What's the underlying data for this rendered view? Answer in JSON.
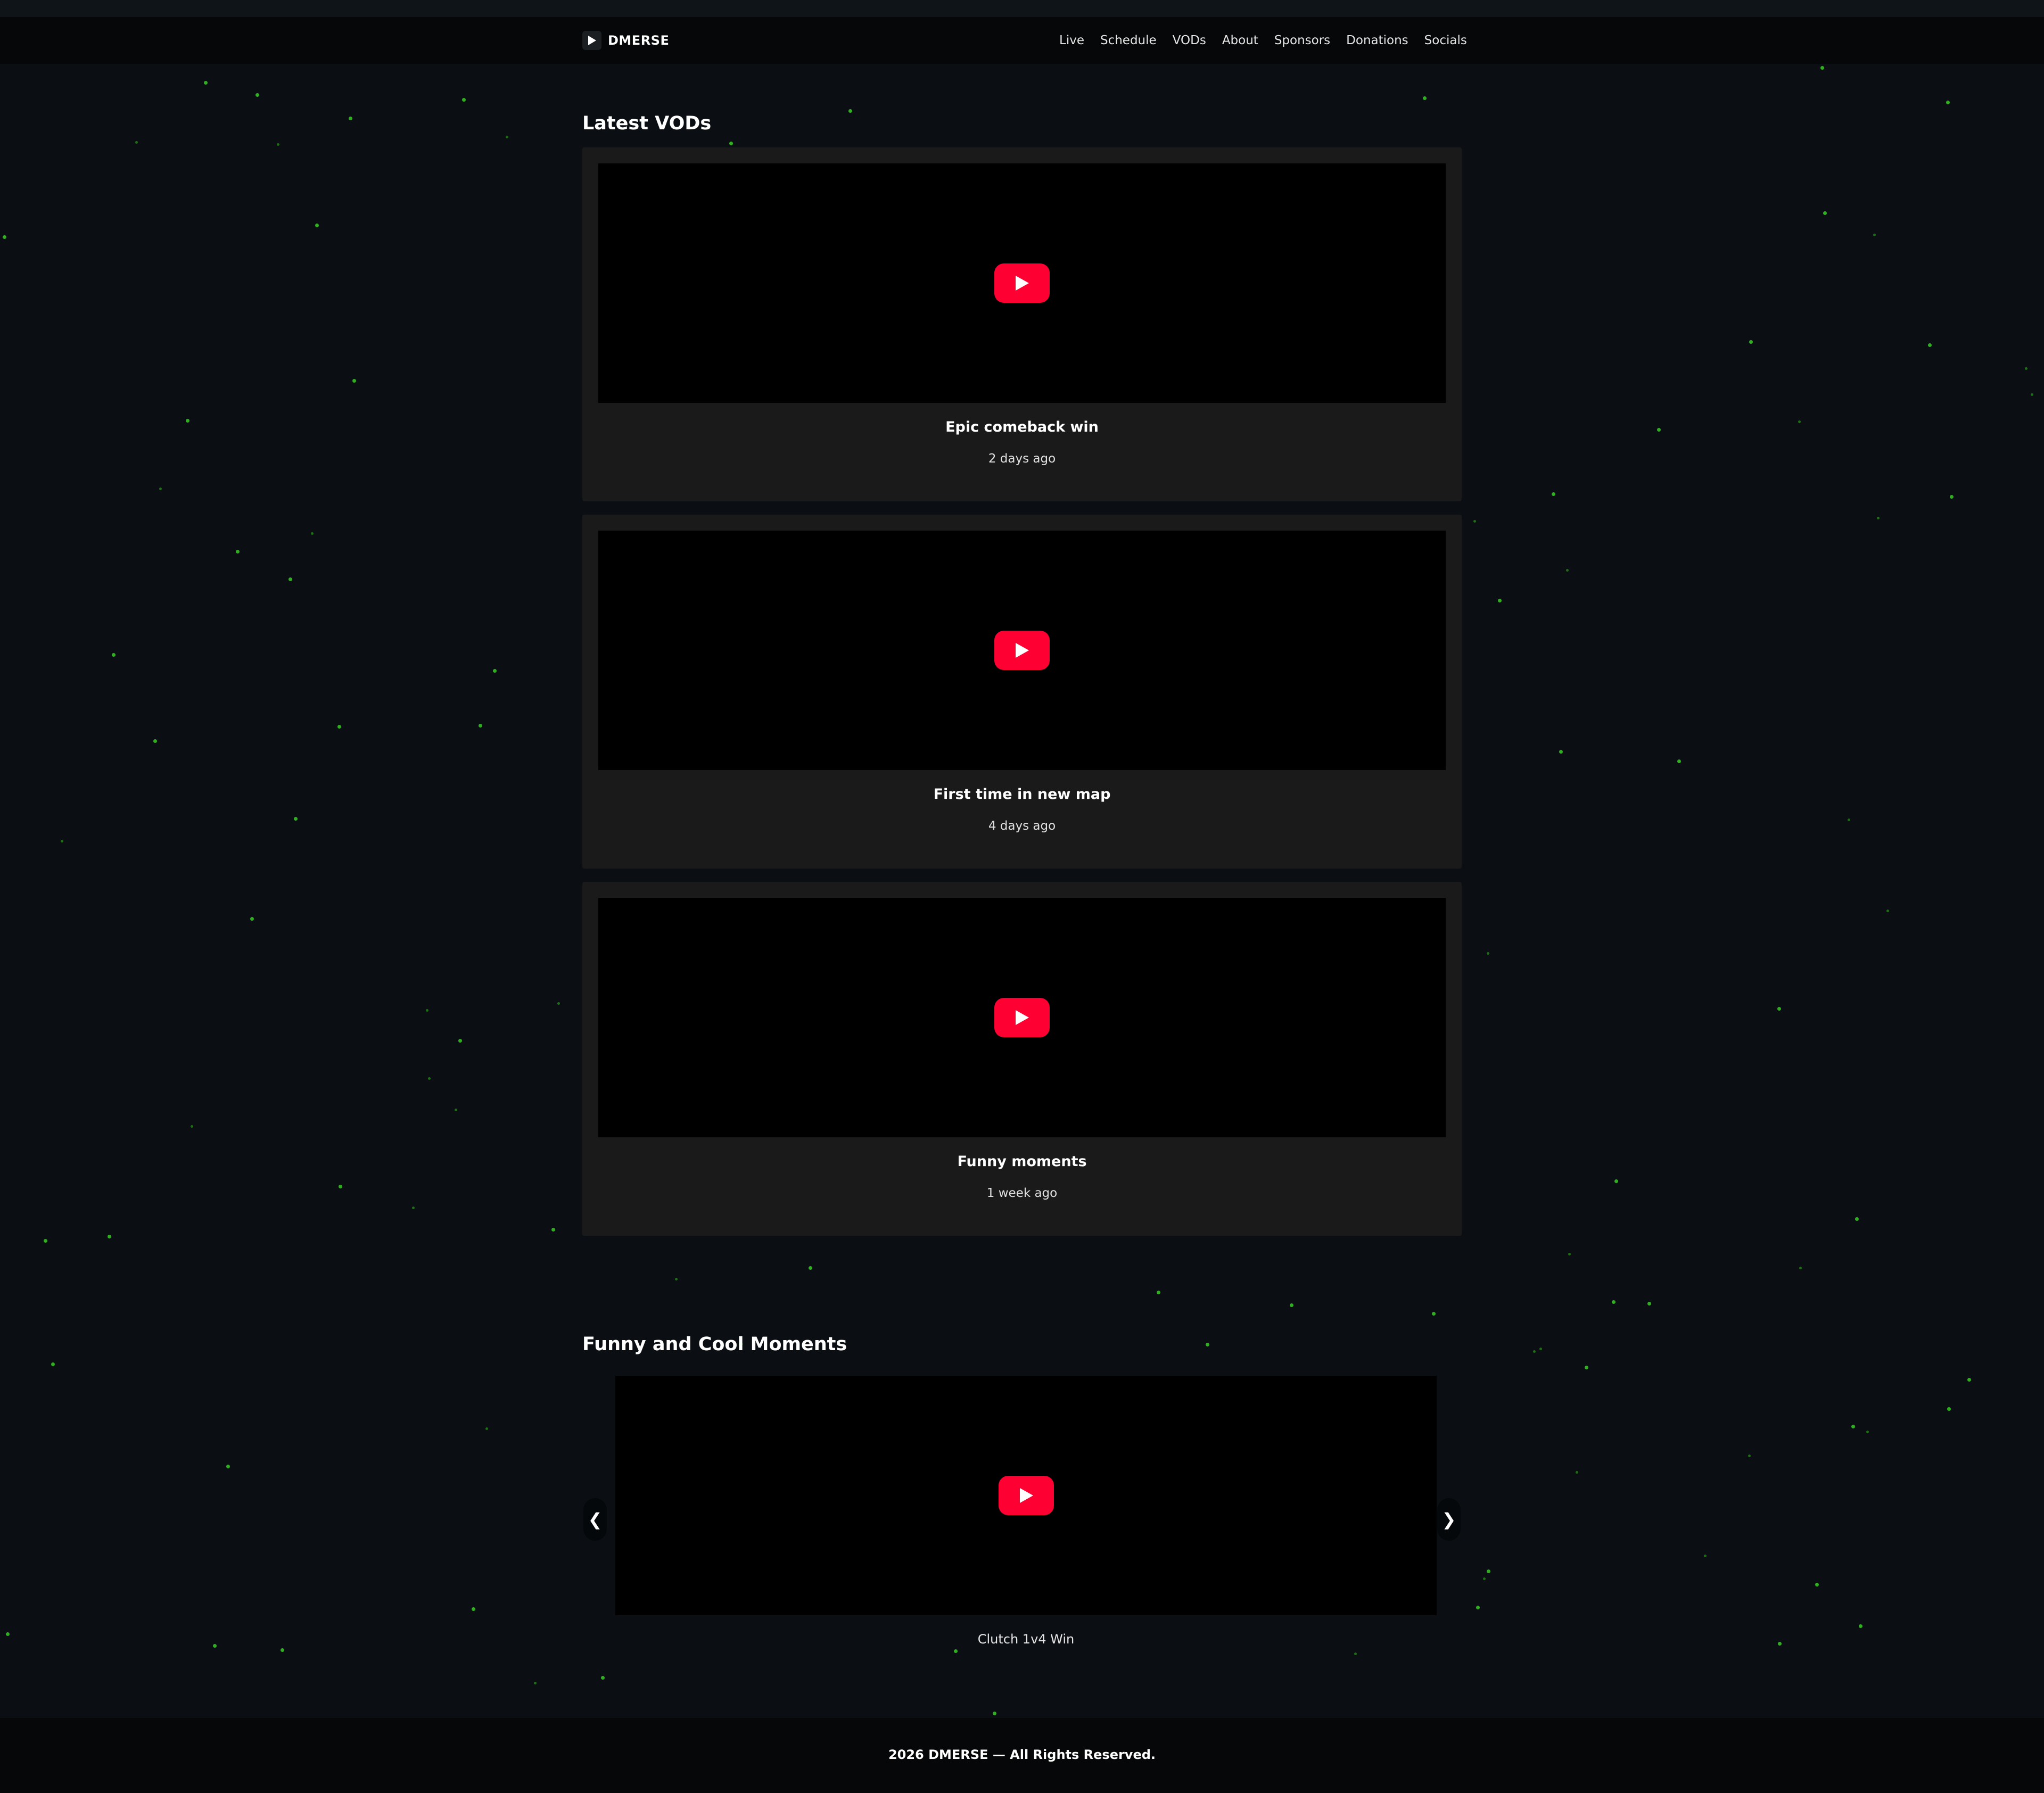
{
  "brand": {
    "name": "DMERSE",
    "icon": "play-icon"
  },
  "nav": {
    "items": [
      {
        "label": "Live"
      },
      {
        "label": "Schedule"
      },
      {
        "label": "VODs"
      },
      {
        "label": "About"
      },
      {
        "label": "Sponsors"
      },
      {
        "label": "Donations"
      },
      {
        "label": "Socials"
      }
    ]
  },
  "vods": {
    "heading": "Latest VODs",
    "items": [
      {
        "title": "Epic comeback win",
        "date": "2 days ago"
      },
      {
        "title": "First time in new map",
        "date": "4 days ago"
      },
      {
        "title": "Funny moments",
        "date": "1 week ago"
      }
    ]
  },
  "moments": {
    "heading": "Funny and Cool Moments",
    "prev_label": "❮",
    "next_label": "❯",
    "caption": "Clutch 1v4 Win"
  },
  "footer": {
    "text": "2026 DMERSE — All Rights Reserved."
  },
  "colors": {
    "background": "#0b0f13",
    "header": "#050708",
    "card": "#1a1a1a",
    "player": "#000000",
    "play_button": "#ff0033",
    "star": "#2fae1f"
  }
}
